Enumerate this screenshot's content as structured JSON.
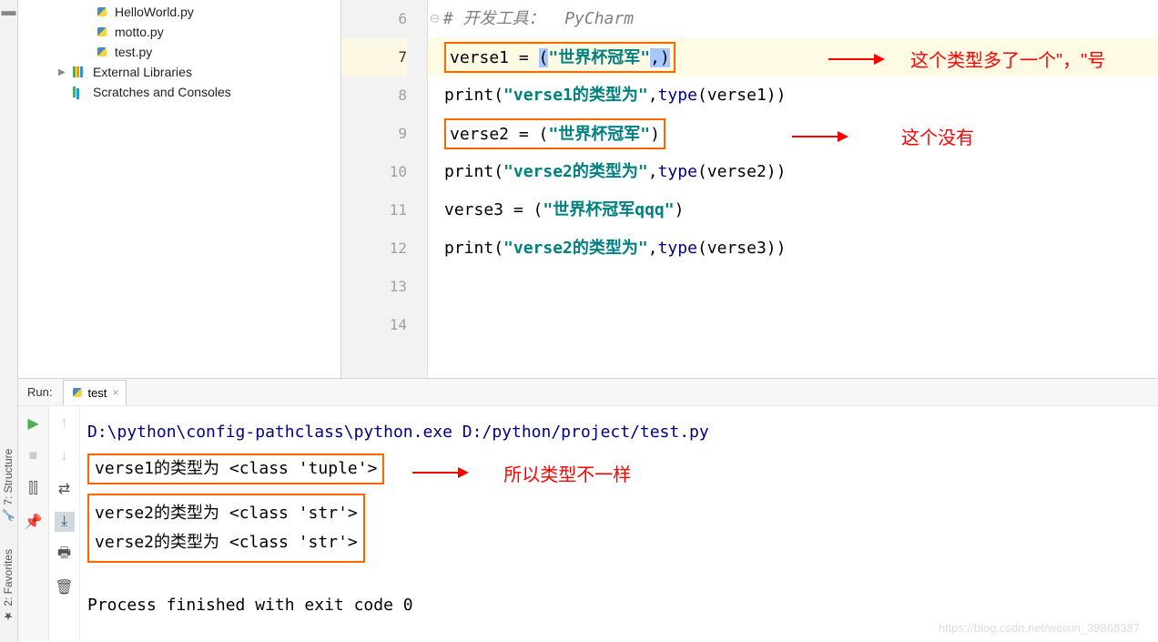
{
  "project": {
    "files": [
      {
        "name": "HelloWorld.py"
      },
      {
        "name": "motto.py"
      },
      {
        "name": "test.py"
      }
    ],
    "external_libs": "External Libraries",
    "scratches": "Scratches and Consoles"
  },
  "editor": {
    "lines": [
      {
        "n": 6,
        "comment": "# 开发工具：  PyCharm"
      },
      {
        "n": 7,
        "var": "verse1",
        "op": " = ",
        "paren_l": "(",
        "str": "\"世界杯冠军\"",
        "tail": ",",
        "paren_r": ")",
        "active": true,
        "boxed": true
      },
      {
        "n": 8,
        "func": "print",
        "paren_l": "(",
        "str": "\"verse1的类型为\"",
        "comma": ",",
        "builtin": "type",
        "arg": "(verse1))"
      },
      {
        "n": 9,
        "var": "verse2",
        "op": " = ",
        "paren_l": "(",
        "str": "\"世界杯冠军\"",
        "paren_r": ")",
        "boxed": true
      },
      {
        "n": 10,
        "func": "print",
        "paren_l": "(",
        "str": "\"verse2的类型为\"",
        "comma": ",",
        "builtin": "type",
        "arg": "(verse2))"
      },
      {
        "n": 11,
        "var": "verse3",
        "op": " = ",
        "paren_l": "(",
        "str": "\"世界杯冠军qqq\"",
        "paren_r": ")"
      },
      {
        "n": 12,
        "func": "print",
        "paren_l": "(",
        "str": "\"verse2的类型为\"",
        "comma": ",",
        "builtin": "type",
        "arg": "(verse3))"
      },
      {
        "n": 13
      },
      {
        "n": 14
      }
    ],
    "note1": "这个类型多了一个\"，\"号",
    "note2": "这个没有"
  },
  "run": {
    "label": "Run:",
    "tab": "test",
    "cmd": "D:\\python\\config-pathclass\\python.exe D:/python/project/test.py",
    "out1": "verse1的类型为 <class 'tuple'>",
    "out2a": "verse2的类型为 <class 'str'>",
    "out2b": "verse2的类型为 <class 'str'>",
    "note": "所以类型不一样",
    "exit": "Process finished with exit code 0"
  },
  "sidebar": {
    "structure": "7: Structure",
    "favorites": "2: Favorites"
  },
  "watermark": "https://blog.csdn.net/weixin_39868387"
}
